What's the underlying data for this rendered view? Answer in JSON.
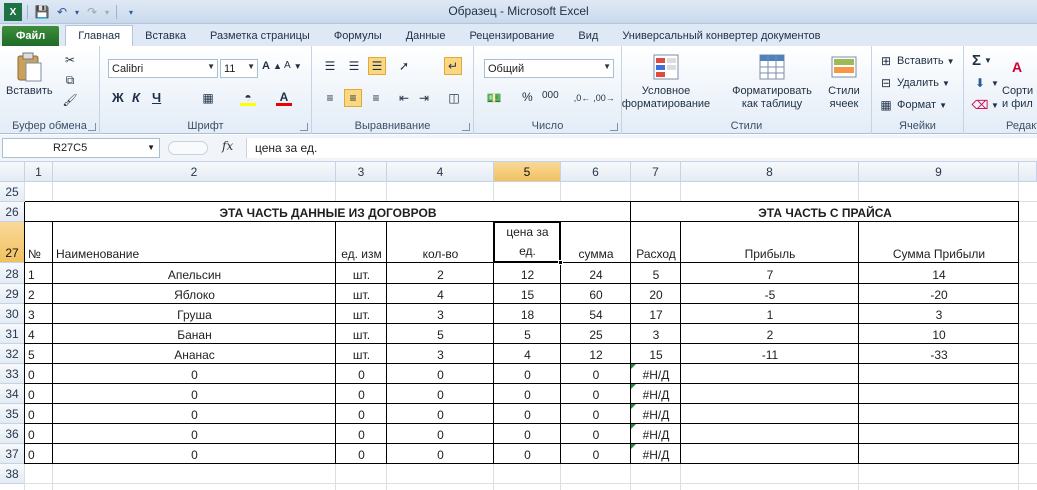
{
  "window": {
    "title": "Образец  -  Microsoft Excel"
  },
  "tabs": [
    {
      "label": "Файл"
    },
    {
      "label": "Главная"
    },
    {
      "label": "Вставка"
    },
    {
      "label": "Разметка страницы"
    },
    {
      "label": "Формулы"
    },
    {
      "label": "Данные"
    },
    {
      "label": "Рецензирование"
    },
    {
      "label": "Вид"
    },
    {
      "label": "Универсальный конвертер документов"
    }
  ],
  "ribbon": {
    "clipboard": {
      "paste": "Вставить",
      "label": "Буфер обмена"
    },
    "font": {
      "name": "Calibri",
      "size": "11",
      "label": "Шрифт",
      "bold": "Ж",
      "italic": "К",
      "underline": "Ч"
    },
    "alignment": {
      "label": "Выравнивание"
    },
    "number": {
      "format": "Общий",
      "label": "Число",
      "percent": "%",
      "thousands": "000"
    },
    "styles": {
      "conditional": "Условное форматирование",
      "as_table": "Форматировать как таблицу",
      "cell_styles": "Стили ячеек",
      "label": "Стили"
    },
    "cells": {
      "insert": "Вставить",
      "delete": "Удалить",
      "format": "Формат",
      "label": "Ячейки"
    },
    "editing": {
      "sort": "Сорти и фил",
      "label": "Редакт"
    }
  },
  "formula_bar": {
    "name_box": "R27C5",
    "fx": "fx",
    "formula": "цена за ед."
  },
  "grid": {
    "columns": [
      "1",
      "2",
      "3",
      "4",
      "5",
      "6",
      "7",
      "8",
      "9"
    ],
    "rows": [
      "25",
      "26",
      "27",
      "28",
      "29",
      "30",
      "31",
      "32",
      "33",
      "34",
      "35",
      "36",
      "37",
      "38"
    ],
    "section_left": "ЭТА ЧАСТЬ ДАННЫЕ ИЗ ДОГОВРОВ",
    "section_right": "ЭТА ЧАСТЬ С ПРАЙСА",
    "headers": [
      "№",
      "Наименование",
      "ед. изм",
      "кол-во",
      "цена за ед.",
      "сумма",
      "Расход",
      "Прибыль",
      "Сумма Прибыли"
    ],
    "header_price_line1": "цена за",
    "header_price_line2": "ед.",
    "data": [
      [
        "1",
        "Апельсин",
        "шт.",
        "2",
        "12",
        "24",
        "5",
        "7",
        "14"
      ],
      [
        "2",
        "Яблоко",
        "шт.",
        "4",
        "15",
        "60",
        "20",
        "-5",
        "-20"
      ],
      [
        "3",
        "Груша",
        "шт.",
        "3",
        "18",
        "54",
        "17",
        "1",
        "3"
      ],
      [
        "4",
        "Банан",
        "шт.",
        "5",
        "5",
        "25",
        "3",
        "2",
        "10"
      ],
      [
        "5",
        "Ананас",
        "шт.",
        "3",
        "4",
        "12",
        "15",
        "-11",
        "-33"
      ],
      [
        "0",
        "0",
        "0",
        "0",
        "0",
        "0",
        "#Н/Д",
        "",
        ""
      ],
      [
        "0",
        "0",
        "0",
        "0",
        "0",
        "0",
        "#Н/Д",
        "",
        ""
      ],
      [
        "0",
        "0",
        "0",
        "0",
        "0",
        "0",
        "#Н/Д",
        "",
        ""
      ],
      [
        "0",
        "0",
        "0",
        "0",
        "0",
        "0",
        "#Н/Д",
        "",
        ""
      ],
      [
        "0",
        "0",
        "0",
        "0",
        "0",
        "0",
        "#Н/Д",
        "",
        ""
      ]
    ],
    "selected_cell": {
      "row": "27",
      "column": "5"
    },
    "error_indicator_color": "#1e8b3e"
  }
}
